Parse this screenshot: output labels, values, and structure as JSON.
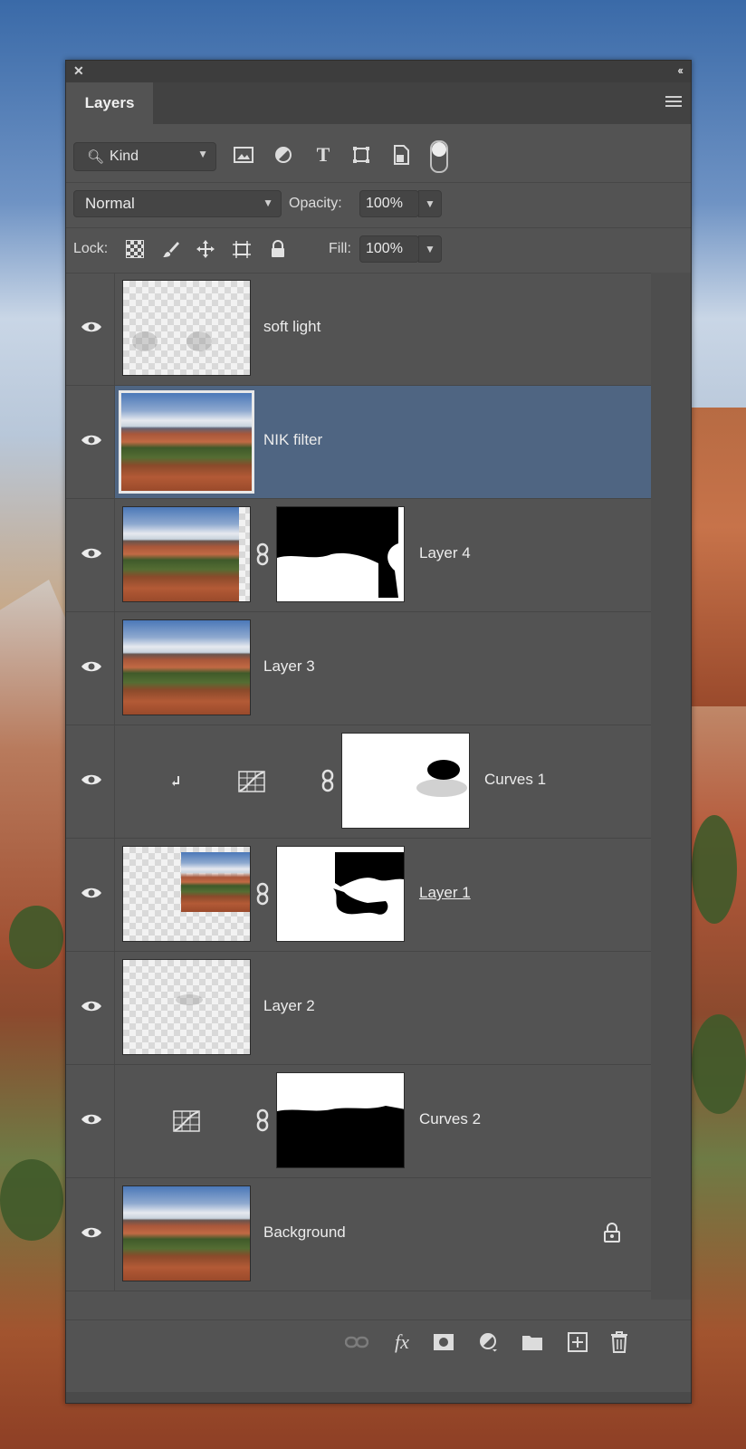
{
  "panel": {
    "close_icon": "close-icon",
    "collapse_icon": "double-chevron-left-icon",
    "tab_label": "Layers",
    "menu_icon": "hamburger-menu-icon"
  },
  "filter": {
    "kind_label": "Kind",
    "icons": [
      "image-filter-icon",
      "adjustment-filter-icon",
      "type-filter-icon",
      "shape-filter-icon",
      "smart-object-filter-icon",
      "filter-toggle-icon"
    ]
  },
  "blend": {
    "mode": "Normal",
    "opacity_label": "Opacity:",
    "opacity_value": "100%",
    "fill_label": "Fill:",
    "fill_value": "100%"
  },
  "lock": {
    "label": "Lock:",
    "icons": [
      "lock-transparent-pixels-icon",
      "lock-image-pixels-icon",
      "lock-position-icon",
      "lock-artboard-icon",
      "lock-all-icon"
    ]
  },
  "layers": [
    {
      "name": "soft light",
      "type": "pixel-transparent",
      "selected": false,
      "has_mask": false
    },
    {
      "name": "NIK filter",
      "type": "photo",
      "selected": true,
      "has_mask": false
    },
    {
      "name": "Layer 4",
      "type": "photo",
      "selected": false,
      "has_mask": true
    },
    {
      "name": "Layer 3",
      "type": "photo",
      "selected": false,
      "has_mask": false
    },
    {
      "name": "Curves 1",
      "type": "adjustment-curves",
      "clipped": true,
      "selected": false,
      "has_mask": true
    },
    {
      "name": "Layer 1",
      "type": "partial-photo",
      "selected": false,
      "has_mask": true
    },
    {
      "name": "Layer 2",
      "type": "pixel-transparent",
      "selected": false,
      "has_mask": false
    },
    {
      "name": "Curves 2",
      "type": "adjustment-curves",
      "selected": false,
      "has_mask": true
    },
    {
      "name": "Background",
      "type": "photo",
      "selected": false,
      "locked": true,
      "has_mask": false
    }
  ],
  "bottom_icons": [
    "link-layers-icon",
    "fx-icon",
    "add-mask-icon",
    "new-adjustment-icon",
    "new-group-icon",
    "new-layer-icon",
    "delete-icon"
  ],
  "bottom_fx_label": "fx"
}
